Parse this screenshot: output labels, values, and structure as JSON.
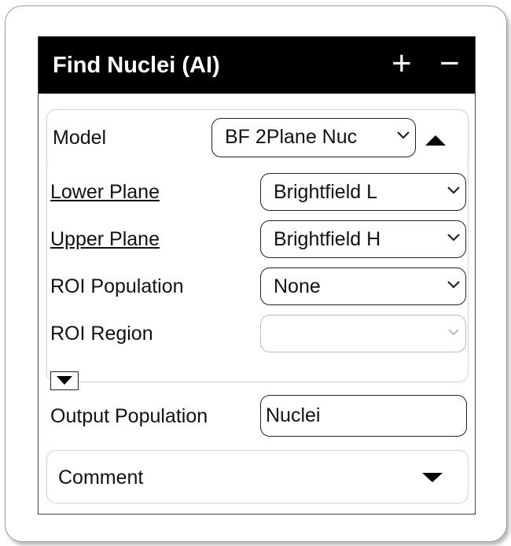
{
  "panel": {
    "title": "Find Nuclei (AI)",
    "add_symbol": "+",
    "remove_symbol": "−"
  },
  "model": {
    "label": "Model",
    "selected": "BF 2Plane Nuc"
  },
  "params": [
    {
      "label": "Lower Plane",
      "value": "Brightfield L"
    },
    {
      "label": "Upper Plane",
      "value": "Brightfield H"
    },
    {
      "label": "ROI Population",
      "value": "None"
    },
    {
      "label": "ROI Region",
      "value": ""
    }
  ],
  "output": {
    "label": "Output Population",
    "value": "Nuclei"
  },
  "comment": {
    "label": "Comment"
  }
}
